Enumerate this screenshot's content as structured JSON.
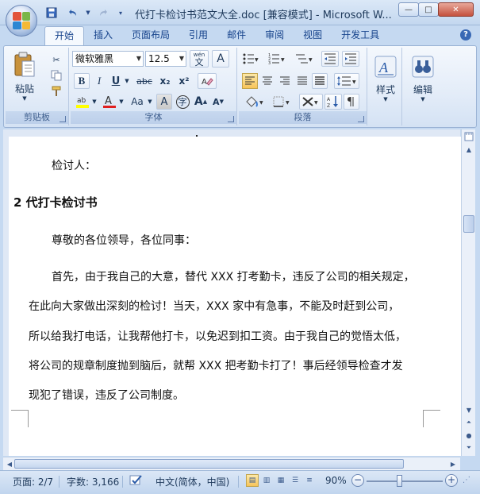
{
  "window": {
    "title": "代打卡检讨书范文大全.doc [兼容模式] - Microsoft W...",
    "minimize_label": "—",
    "maximize_label": "□",
    "close_label": "✕"
  },
  "qat": {
    "save_icon": "save-icon",
    "undo_icon": "undo-icon",
    "redo_icon": "redo-icon",
    "customize_icon": "chevron-down-icon"
  },
  "tabs": [
    {
      "label": "开始",
      "active": true
    },
    {
      "label": "插入"
    },
    {
      "label": "页面布局"
    },
    {
      "label": "引用"
    },
    {
      "label": "邮件"
    },
    {
      "label": "审阅"
    },
    {
      "label": "视图"
    },
    {
      "label": "开发工具"
    }
  ],
  "ribbon": {
    "clipboard": {
      "label": "剪贴板",
      "paste_label": "粘贴"
    },
    "font": {
      "label": "字体",
      "font_name": "微软雅黑",
      "font_size": "12.5",
      "bold": "B",
      "italic": "I",
      "underline": "U",
      "strike": "abc",
      "subscript": "x₂",
      "superscript": "x²",
      "change_case": "Aa",
      "grow": "A",
      "shrink": "A",
      "char_border": "A",
      "enclose": "字",
      "phonetic": "wén"
    },
    "paragraph": {
      "label": "段落"
    },
    "styles": {
      "label": "样式"
    },
    "editing": {
      "label": "编辑"
    }
  },
  "document": {
    "signature_line": "检讨人：",
    "heading": "2 代打卡检讨书",
    "salutation": "尊敬的各位领导，各位同事：",
    "body_lines": [
      "首先，由于我自己的大意，替代 XXX 打考勤卡，违反了公司的相关规定，",
      "在此向大家做出深刻的检讨！当天，XXX 家中有急事，不能及时赶到公司，",
      "所以给我打电话，让我帮他打卡，以免迟到扣工资。由于我自己的觉悟太低，",
      "将公司的规章制度抛到脑后，就帮 XXX 把考勤卡打了！事后经领导检查才发",
      "现犯了错误，违反了公司制度。"
    ]
  },
  "statusbar": {
    "page": "页面: 2/7",
    "words": "字数: 3,166",
    "language": "中文(简体，中国)",
    "zoom": "90%",
    "zoom_minus": "−",
    "zoom_plus": "+"
  }
}
